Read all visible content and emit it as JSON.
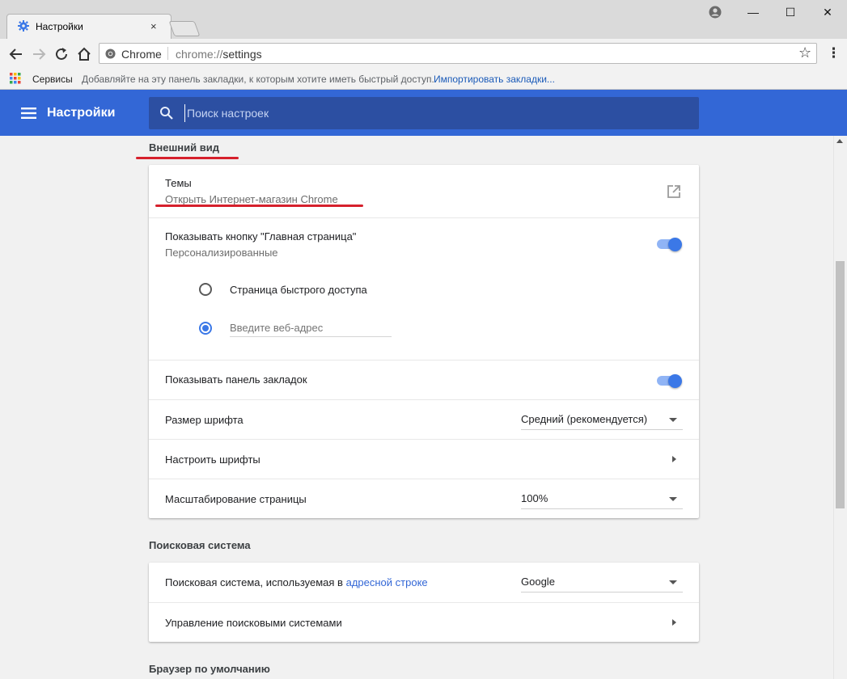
{
  "window": {
    "tab_title": "Настройки",
    "tab_close": "×",
    "minimize": "—",
    "maximize": "☐",
    "close": "✕"
  },
  "toolbar": {
    "site_chip": "Chrome",
    "url_scheme": "chrome://",
    "url_path": "settings",
    "star": "☆",
    "menu": "⋮"
  },
  "bookmarks": {
    "services": "Сервисы",
    "hint": "Добавляйте на эту панель закладки, к которым хотите иметь быстрый доступ.",
    "import_link": "Импортировать закладки..."
  },
  "header": {
    "title": "Настройки",
    "search_placeholder": "Поиск настроек"
  },
  "appearance": {
    "title": "Внешний вид",
    "themes": {
      "label": "Темы",
      "sub": "Открыть Интернет-магазин Chrome"
    },
    "home_button": {
      "label": "Показывать кнопку \"Главная страница\"",
      "sub": "Персонализированные",
      "enabled": true,
      "option_ntp": "Страница быстрого доступа",
      "option_url_placeholder": "Введите веб-адрес",
      "selected": "url"
    },
    "bookmarks_bar": {
      "label": "Показывать панель закладок",
      "enabled": true
    },
    "font_size": {
      "label": "Размер шрифта",
      "value": "Средний (рекомендуется)"
    },
    "customize_fonts": {
      "label": "Настроить шрифты"
    },
    "page_zoom": {
      "label": "Масштабирование страницы",
      "value": "100%"
    }
  },
  "search_engine": {
    "title": "Поисковая система",
    "used_label_prefix": "Поисковая система, используемая в",
    "used_label_link": "адресной строке",
    "used_value": "Google",
    "manage_label": "Управление поисковыми системами"
  },
  "default_browser": {
    "title": "Браузер по умолчанию"
  },
  "colors": {
    "header": "#3367d6",
    "search_bg": "#2c4fa2",
    "toggle_on": "#3b78e7",
    "annotation_underline": "#d6202c"
  }
}
